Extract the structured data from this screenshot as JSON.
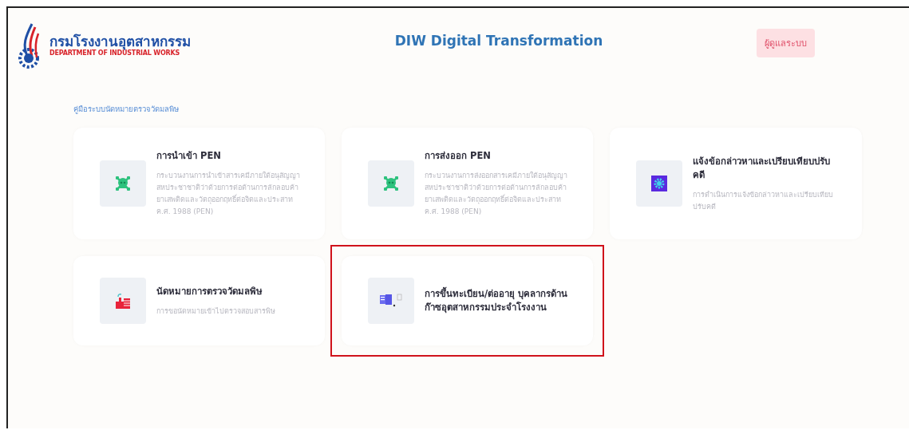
{
  "header": {
    "logo_thai": "กรมโรงงานอุตสาหกรรม",
    "logo_english": "DEPARTMENT OF INDUSTRIAL WORKS",
    "title": "DIW Digital Transformation",
    "admin_button": "ผู้ดูแลระบบ"
  },
  "breadcrumb": "คู่มือระบบนัดหมายตรวจวัดมลพิษ",
  "cards": [
    {
      "kind": "skull",
      "title": "การนำเข้า PEN",
      "description": "กระบวนงานการนำเข้าสารเคมีภายใต้อนุสัญญาสหประชาชาติว่าด้วยการต่อต้านการลักลอบค้ายาเสพติดและวัตถุออกฤทธิ์ต่อจิตและประสาท ค.ศ. 1988 (PEN)",
      "highlighted": false
    },
    {
      "kind": "skull",
      "title": "การส่งออก PEN",
      "description": "กระบวนงานการส่งออกสารเคมีภายใต้อนุสัญญาสหประชาชาติว่าด้วยการต่อต้านการลักลอบค้ายาเสพติดและวัตถุออกฤทธิ์ต่อจิตและประสาท ค.ศ. 1988 (PEN)",
      "highlighted": false
    },
    {
      "kind": "gear",
      "title": "แจ้งข้อกล่าวหาและเปรียบเทียบปรับคดี",
      "description": "การดำเนินการแจ้งข้อกล่าวหาและเปรียบเทียบปรับคดี",
      "highlighted": false
    },
    {
      "kind": "factory",
      "title": "นัดหมายการตรวจวัดมลพิษ",
      "description": "การขอนัดหมายเข้าไปตรวจสอบสารพิษ",
      "highlighted": false
    },
    {
      "kind": "documents",
      "title": "การขึ้นทะเบียน/ต่ออายุ บุคลากรด้านก๊าซอุตสาหกรรมประจำโรงงาน",
      "highlighted": true
    }
  ]
}
